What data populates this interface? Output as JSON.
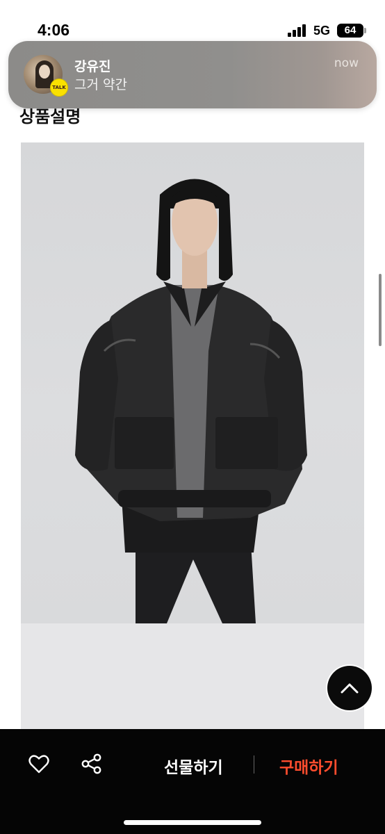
{
  "status_bar": {
    "time": "4:06",
    "network": "5G",
    "battery": "64"
  },
  "notification": {
    "sender": "강유진",
    "message": "그거 약간",
    "time": "now",
    "app_badge": "TALK",
    "badge_color": "#fae100"
  },
  "page": {
    "section_heading": "상품설명"
  },
  "product": {
    "image_icon": "product-photo-leather-jacket"
  },
  "bottom_bar": {
    "like_icon": "heart-icon",
    "share_icon": "share-icon",
    "gift_label": "선물하기",
    "buy_label": "구매하기",
    "buy_color": "#ff4d2e"
  }
}
